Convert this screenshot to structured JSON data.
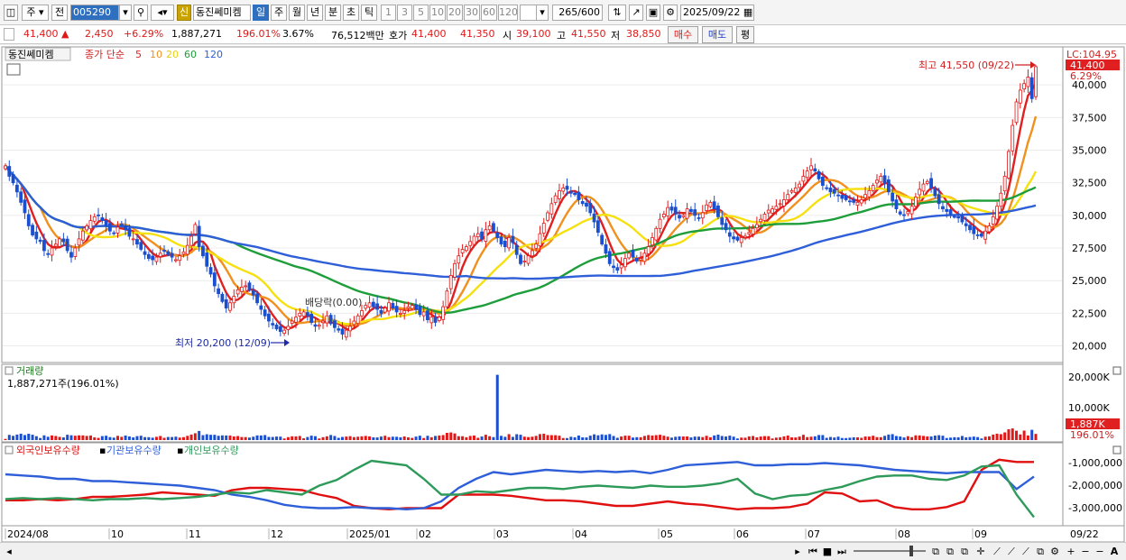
{
  "toolbar": {
    "period_label": "주",
    "prev_label": "전",
    "stock_code": "005290",
    "signal_badge": "신",
    "stock_name": "동진쎄미켐",
    "period_day": "일",
    "period_week": "주",
    "period_month": "월",
    "period_year": "년",
    "period_min": "분",
    "period_sec": "초",
    "period_tick": "틱",
    "intervals": [
      "1",
      "3",
      "5",
      "10",
      "20",
      "30",
      "60",
      "120"
    ],
    "count_value": "265",
    "count_max": "/600",
    "date_value": "2025/09/22"
  },
  "quote": {
    "price": "41,400",
    "change_arrow": "▲",
    "change": "2,450",
    "change_pct": "+6.29%",
    "volume": "1,887,271",
    "volume_ratio": "196.01%",
    "turnover_rate": "3.67%",
    "amount": "76,512백만",
    "ask_label": "호가",
    "ask": "41,400",
    "bid": "41,350",
    "open_label": "시",
    "open": "39,100",
    "high_label": "고",
    "high": "41,550",
    "low_label": "저",
    "low": "38,850",
    "buy_label": "매수",
    "sell_label": "매도",
    "eval_label": "평"
  },
  "price_panel": {
    "stock_tag": "동진쎄미켐",
    "indicator_label": "종가 단순",
    "ma_periods": [
      "5",
      "10",
      "20",
      "60",
      "120"
    ],
    "ma_colors": [
      "#e02020",
      "#f0901e",
      "#f5e010",
      "#1e9e3a",
      "#2f5fd8"
    ],
    "high_annotation": "최고 41,550 (09/22)",
    "low_annotation": "최저 20,200 (12/09)",
    "dividend_annotation": "배당락(0.00)",
    "lc_label": "LC:104.95",
    "last_price_tag": "41,400",
    "last_change_tag": "6.29%",
    "y_ticks": [
      "40,000",
      "37,500",
      "35,000",
      "32,500",
      "30,000",
      "27,500",
      "25,000",
      "22,500",
      "20,000"
    ]
  },
  "volume_panel": {
    "title": "거래량",
    "value_label": "1,887,271주(196.01%)",
    "y_ticks": [
      "20,000K",
      "10,000K"
    ],
    "last_volume_tag": "1,887K",
    "last_ratio_tag": "196.01%"
  },
  "holding_panel": {
    "legend": [
      "외국인보유수량",
      "기관보유수량",
      "개인보유수량"
    ],
    "legend_colors": [
      "#e01010",
      "#2f5fd8",
      "#2e9a5a"
    ],
    "y_ticks": [
      "-1,000,000",
      "-2,000,000",
      "-3,000,000"
    ]
  },
  "x_axis": {
    "labels": [
      "2024/08",
      "10",
      "11",
      "12",
      "2025/01",
      "02",
      "03",
      "04",
      "05",
      "06",
      "07",
      "08",
      "09"
    ],
    "last_date": "09/22"
  },
  "chart_data": {
    "type": "candlestick",
    "title": "",
    "x_start": "2024/08",
    "x_end": "2025/09/22",
    "ylim": [
      19000,
      42500
    ],
    "close": [
      33800,
      33000,
      32500,
      31800,
      31000,
      30200,
      29200,
      28500,
      28200,
      28000,
      27300,
      27000,
      27500,
      27800,
      28200,
      28000,
      27300,
      26800,
      27500,
      28200,
      28800,
      29200,
      29600,
      29900,
      30000,
      29600,
      29200,
      28800,
      28600,
      29100,
      29300,
      28900,
      28400,
      28200,
      27800,
      27400,
      27000,
      26700,
      26600,
      26800,
      27100,
      27300,
      27000,
      26800,
      26600,
      26900,
      27200,
      27700,
      28400,
      29300,
      27600,
      26900,
      26100,
      25500,
      24600,
      24000,
      23400,
      22900,
      23300,
      23800,
      24300,
      24500,
      24600,
      24300,
      23900,
      23300,
      22800,
      22300,
      21900,
      21600,
      21300,
      21100,
      21200,
      21500,
      21900,
      22200,
      22500,
      22600,
      22300,
      21800,
      21500,
      21600,
      21900,
      22300,
      21700,
      21400,
      21200,
      20900,
      21200,
      21500,
      21900,
      22300,
      22700,
      23100,
      23300,
      23000,
      22800,
      22500,
      22900,
      23300,
      22900,
      22600,
      22500,
      22700,
      23000,
      23100,
      22800,
      22400,
      22600,
      22000,
      22200,
      21800,
      22200,
      23000,
      24200,
      25400,
      26300,
      26900,
      27400,
      27600,
      28000,
      28400,
      28600,
      28200,
      28900,
      29200,
      28800,
      28300,
      27800,
      27600,
      28300,
      27900,
      27000,
      26300,
      26500,
      26900,
      27300,
      27800,
      28600,
      29400,
      30200,
      30900,
      31500,
      31900,
      32100,
      32000,
      31700,
      31600,
      31200,
      30900,
      30700,
      30200,
      29500,
      28700,
      27800,
      27100,
      26300,
      26000,
      25800,
      26200,
      26700,
      27100,
      26800,
      26500,
      26700,
      27100,
      27600,
      28300,
      29000,
      29700,
      30100,
      30600,
      30400,
      30100,
      29800,
      30000,
      30500,
      30300,
      30000,
      29800,
      30200,
      30800,
      31000,
      30500,
      29900,
      29300,
      28900,
      28400,
      28200,
      28100,
      28300,
      28400,
      28700,
      29000,
      29300,
      29700,
      30100,
      30400,
      30500,
      30700,
      30900,
      31200,
      31600,
      31900,
      32100,
      32400,
      33000,
      33400,
      33800,
      33400,
      32800,
      32300,
      32100,
      31800,
      31700,
      31500,
      31300,
      31200,
      31100,
      31000,
      31000,
      31200,
      31600,
      31900,
      32300,
      32700,
      33000,
      32500,
      31800,
      31100,
      30500,
      30100,
      30000,
      30300,
      30700,
      31400,
      32000,
      32400,
      32600,
      32100,
      31500,
      30900,
      30500,
      30300,
      30100,
      29900,
      29800,
      29500,
      29200,
      28900,
      28600,
      28500,
      28400,
      28800,
      29200,
      29900,
      30700,
      31700,
      33000,
      34900,
      36900,
      38700,
      39600,
      40100,
      40600,
      38950,
      41400
    ],
    "series": [
      {
        "name": "5",
        "color": "#e02020"
      },
      {
        "name": "10",
        "color": "#f0901e"
      },
      {
        "name": "20",
        "color": "#f5e010"
      },
      {
        "name": "60",
        "color": "#1e9e3a"
      },
      {
        "name": "120",
        "color": "#2f5fd8"
      }
    ],
    "holding": {
      "foreign": [
        -2.55,
        -2.55,
        -2.5,
        -2.55,
        -2.5,
        -2.4,
        -2.4,
        -2.35,
        -2.3,
        -2.2,
        -2.25,
        -2.3,
        -2.35,
        -2.1,
        -2.0,
        -2.0,
        -2.05,
        -2.1,
        -2.3,
        -2.45,
        -2.8,
        -2.9,
        -2.95,
        -2.9,
        -2.9,
        -2.9,
        -2.3,
        -2.3,
        -2.3,
        -2.35,
        -2.45,
        -2.55,
        -2.55,
        -2.6,
        -2.7,
        -2.8,
        -2.8,
        -2.7,
        -2.6,
        -2.7,
        -2.75,
        -2.85,
        -2.95,
        -2.9,
        -2.9,
        -2.85,
        -2.7,
        -2.2,
        -2.25,
        -2.6,
        -2.55,
        -2.85,
        -2.95,
        -2.95,
        -2.85,
        -2.6,
        -1.2,
        -0.75,
        -0.85,
        -0.85
      ],
      "institution": [
        -1.4,
        -1.45,
        -1.5,
        -1.6,
        -1.6,
        -1.7,
        -1.7,
        -1.75,
        -1.8,
        -1.85,
        -1.9,
        -2.0,
        -2.1,
        -2.3,
        -2.4,
        -2.55,
        -2.75,
        -2.85,
        -2.9,
        -2.9,
        -2.85,
        -2.9,
        -2.9,
        -2.95,
        -2.9,
        -2.6,
        -2.0,
        -1.6,
        -1.3,
        -1.4,
        -1.3,
        -1.2,
        -1.25,
        -1.3,
        -1.25,
        -1.3,
        -1.25,
        -1.35,
        -1.2,
        -1.0,
        -0.95,
        -0.9,
        -0.85,
        -1.0,
        -1.0,
        -0.95,
        -0.95,
        -0.9,
        -0.95,
        -1.0,
        -1.1,
        -1.2,
        -1.25,
        -1.3,
        -1.35,
        -1.3,
        -1.3,
        -1.3,
        -2.05,
        -1.5
      ],
      "individual": [
        -2.5,
        -2.45,
        -2.5,
        -2.45,
        -2.5,
        -2.55,
        -2.5,
        -2.5,
        -2.45,
        -2.5,
        -2.45,
        -2.4,
        -2.3,
        -2.2,
        -2.25,
        -2.1,
        -2.2,
        -2.3,
        -1.9,
        -1.65,
        -1.2,
        -0.8,
        -0.9,
        -1.0,
        -1.6,
        -2.3,
        -2.3,
        -2.15,
        -2.2,
        -2.1,
        -2.0,
        -2.0,
        -2.05,
        -1.95,
        -1.9,
        -1.95,
        -2.0,
        -1.9,
        -1.95,
        -1.95,
        -1.9,
        -1.8,
        -1.6,
        -2.25,
        -2.5,
        -2.35,
        -2.3,
        -2.1,
        -1.95,
        -1.7,
        -1.5,
        -1.45,
        -1.45,
        -1.6,
        -1.65,
        -1.45,
        -1.05,
        -1.0,
        -2.3,
        -3.3
      ]
    }
  }
}
